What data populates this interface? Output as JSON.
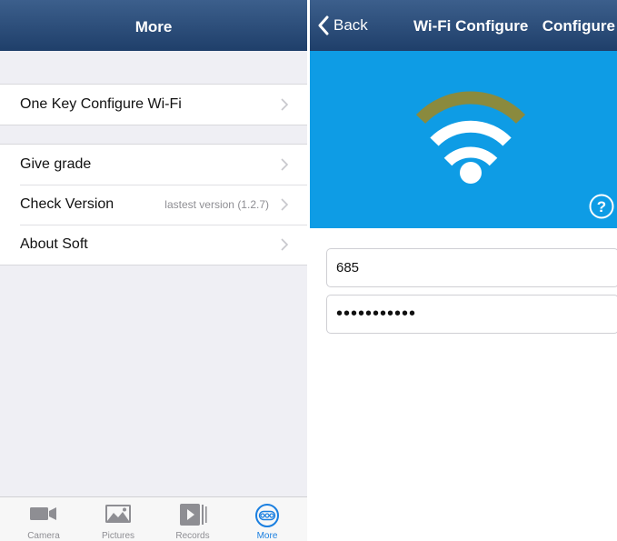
{
  "left": {
    "nav": {
      "title": "More"
    },
    "groups": [
      {
        "items": [
          {
            "label": "One Key Configure Wi-Fi",
            "detail": ""
          }
        ]
      },
      {
        "items": [
          {
            "label": "Give grade",
            "detail": ""
          },
          {
            "label": "Check Version",
            "detail": "lastest version (1.2.7)"
          },
          {
            "label": "About Soft",
            "detail": ""
          }
        ]
      }
    ],
    "tabs": [
      {
        "label": "Camera",
        "icon": "camera-icon"
      },
      {
        "label": "Pictures",
        "icon": "pictures-icon"
      },
      {
        "label": "Records",
        "icon": "records-icon"
      },
      {
        "label": "More",
        "icon": "more-icon",
        "active": true
      }
    ]
  },
  "right": {
    "nav": {
      "back": "Back",
      "title": "Wi-Fi Configure",
      "action": "Configure"
    },
    "form": {
      "ssid": "685",
      "password": "•••••••••••"
    }
  },
  "colors": {
    "nav": "#2a4a76",
    "hero": "#0e9ce5",
    "wifi_outer_arc": "#8a8a3e",
    "tab_active": "#1a7fe0"
  }
}
